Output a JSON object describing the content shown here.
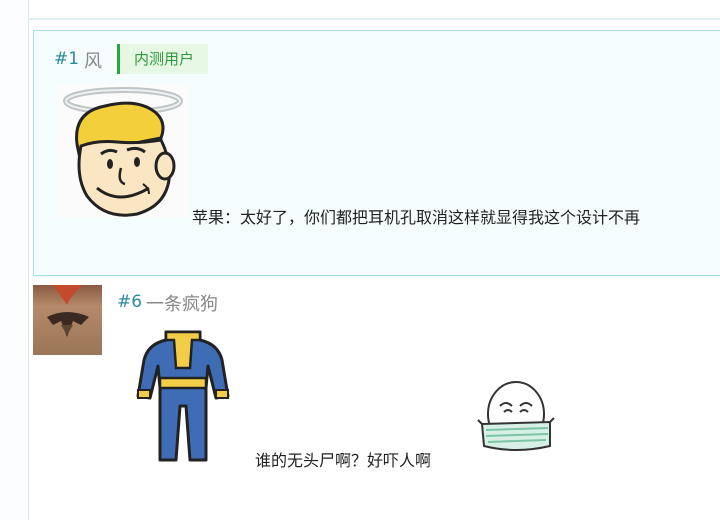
{
  "comments": [
    {
      "floor": "#1",
      "author": "风",
      "badge": "内测用户",
      "avatar_icon": "vault-boy-halo-icon",
      "text": "苹果：太好了，你们都把耳机孔取消这样就显得我这个设计不再"
    },
    {
      "floor": "#6",
      "author": "一条疯狗",
      "avatar_icon": "tattoo-back-photo",
      "attachment_icon": "vault-suit-icon",
      "text": "谁的无头尸啊？好吓人啊",
      "sticker_icon": "masked-face-sticker-icon"
    }
  ],
  "colors": {
    "floor": "#2a8aa0",
    "author": "#888888",
    "badge_bg": "#e6f7e4",
    "badge_text": "#2e9a3b",
    "highlight_bg": "#f4fcfd",
    "highlight_border": "#a9dfe4"
  }
}
